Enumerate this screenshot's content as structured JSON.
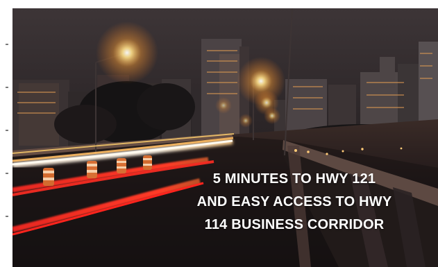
{
  "caption": {
    "lines": [
      "5 MINUTES TO HWY 121",
      "AND EASY ACCESS TO HWY",
      "114 BUSINESS CORRIDOR"
    ],
    "color": "#ffffff"
  },
  "scene": {
    "subject": "city-skyline-night-highway",
    "colors": {
      "sky": "#2d2528",
      "light_trail_red": "#ff2a24",
      "light_trail_white": "#fff7e8",
      "street_light": "#ffb24a"
    }
  }
}
